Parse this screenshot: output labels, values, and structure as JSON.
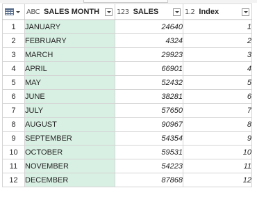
{
  "columns": [
    {
      "type_icon": "ABC",
      "label": "SALES MONTH"
    },
    {
      "type_icon": "123",
      "label": "SALES"
    },
    {
      "type_icon": "1.2",
      "label": "Index"
    }
  ],
  "rows": [
    {
      "n": "1",
      "month": "JANUARY",
      "sales": "24640",
      "index": "1"
    },
    {
      "n": "2",
      "month": "FEBRUARY",
      "sales": "4324",
      "index": "2"
    },
    {
      "n": "3",
      "month": "MARCH",
      "sales": "29923",
      "index": "3"
    },
    {
      "n": "4",
      "month": "APRIL",
      "sales": "66901",
      "index": "4"
    },
    {
      "n": "5",
      "month": "MAY",
      "sales": "52432",
      "index": "5"
    },
    {
      "n": "6",
      "month": "JUNE",
      "sales": "38281",
      "index": "6"
    },
    {
      "n": "7",
      "month": "JULY",
      "sales": "57650",
      "index": "7"
    },
    {
      "n": "8",
      "month": "AUGUST",
      "sales": "90967",
      "index": "8"
    },
    {
      "n": "9",
      "month": "SEPTEMBER",
      "sales": "54354",
      "index": "9"
    },
    {
      "n": "10",
      "month": "OCTOBER",
      "sales": "59531",
      "index": "10"
    },
    {
      "n": "11",
      "month": "NOVEMBER",
      "sales": "54223",
      "index": "11"
    },
    {
      "n": "12",
      "month": "DECEMBER",
      "sales": "87868",
      "index": "12"
    }
  ],
  "colors": {
    "selected_column": "#d8efe3",
    "grid_border": "#d4d4d4"
  },
  "icons": {
    "corner": "table-icon",
    "filter": "chevron-down-icon"
  }
}
